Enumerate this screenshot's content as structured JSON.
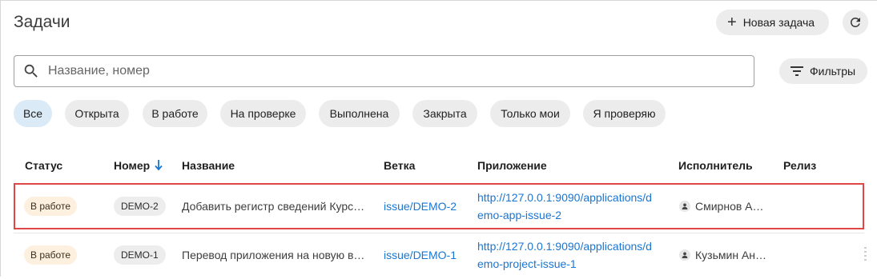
{
  "header": {
    "title": "Задачи",
    "new_task_label": "Новая задача",
    "filters_label": "Фильтры"
  },
  "search": {
    "placeholder": "Название, номер",
    "value": ""
  },
  "chips": [
    {
      "label": "Все",
      "active": true
    },
    {
      "label": "Открыта",
      "active": false
    },
    {
      "label": "В работе",
      "active": false
    },
    {
      "label": "На проверке",
      "active": false
    },
    {
      "label": "Выполнена",
      "active": false
    },
    {
      "label": "Закрыта",
      "active": false
    },
    {
      "label": "Только мои",
      "active": false
    },
    {
      "label": "Я проверяю",
      "active": false
    }
  ],
  "table": {
    "columns": {
      "status": "Статус",
      "number": "Номер",
      "name": "Название",
      "branch": "Ветка",
      "app": "Приложение",
      "assignee": "Исполнитель",
      "release": "Релиз"
    },
    "sort": {
      "column": "number",
      "direction": "desc"
    },
    "rows": [
      {
        "status": "В работе",
        "number": "DEMO-2",
        "name": "Добавить регистр сведений Курс…",
        "branch": "issue/DEMO-2",
        "app_line1": "http://127.0.0.1:9090/applications/d",
        "app_line2": "emo-app-issue-2",
        "assignee": "Смирнов Ан…",
        "release": "",
        "selected": true
      },
      {
        "status": "В работе",
        "number": "DEMO-1",
        "name": "Перевод приложения на новую в…",
        "branch": "issue/DEMO-1",
        "app_line1": "http://127.0.0.1:9090/applications/d",
        "app_line2": "emo-project-issue-1",
        "assignee": "Кузьмин Ан…",
        "release": "",
        "selected": false
      }
    ]
  },
  "colors": {
    "accent": "#1976d2",
    "status_badge_bg": "#fdf0df",
    "chip_active_bg": "#dbeaf7",
    "selection_border": "#e04646"
  }
}
